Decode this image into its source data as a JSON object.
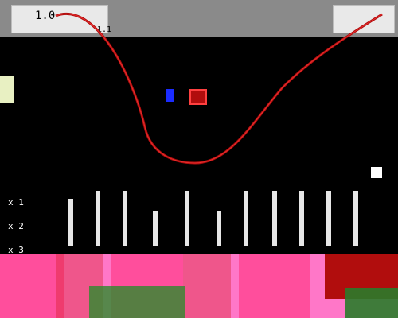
{
  "plot": {
    "y_ticks": [
      "1.0",
      "1.1"
    ],
    "left_legend_labels": [
      "x_1",
      "x_2",
      "x_3"
    ],
    "colors": {
      "background": "#000000",
      "curve": "#b10d0d",
      "curve_highlight": "#ff4040",
      "marker_blue": "#1b2cff",
      "band": "#ff77c8",
      "band_dark": "#b10d0d",
      "grid": "#e7e7e7"
    }
  }
}
